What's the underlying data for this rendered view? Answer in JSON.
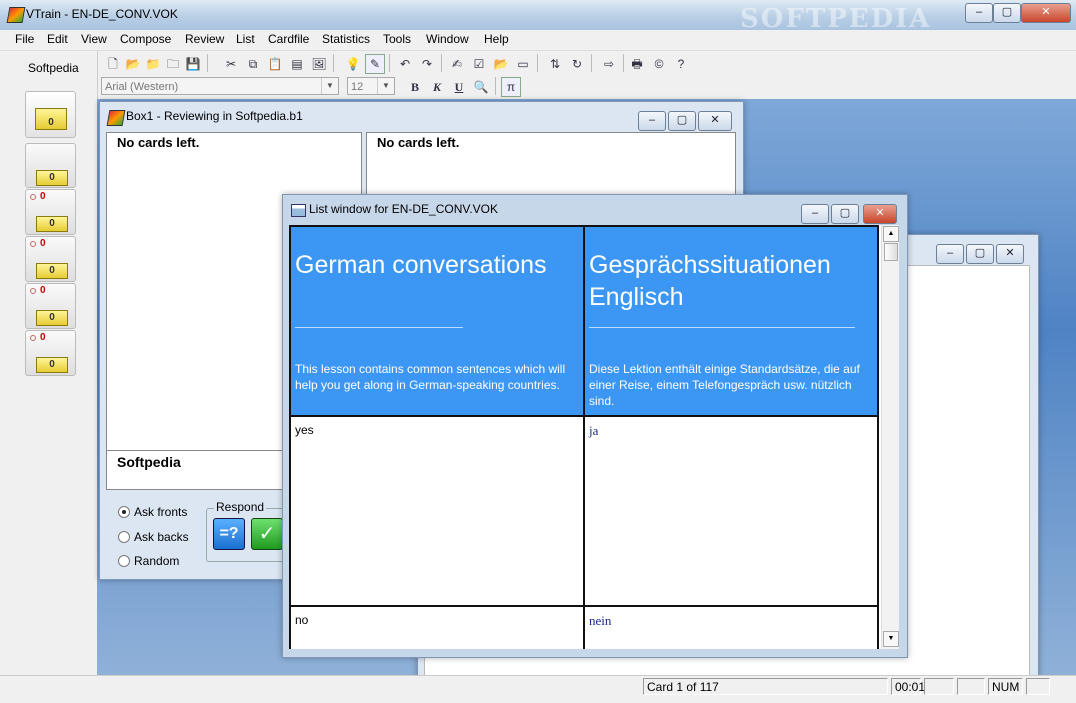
{
  "window": {
    "title": "VTrain - EN-DE_CONV.VOK",
    "watermark": "SOFTPEDIA",
    "min": "–",
    "max": "▢",
    "close": "✕"
  },
  "menu": [
    "File",
    "Edit",
    "View",
    "Compose",
    "Review",
    "List",
    "Cardfile",
    "Statistics",
    "Tools",
    "Window",
    "Help"
  ],
  "toolbar": {
    "font_name": "Arial (Western)",
    "font_size": "12",
    "bold": "B",
    "italic": "K",
    "underline": "U"
  },
  "left_panel": {
    "label": "Softpedia",
    "boxes": [
      {
        "count": "",
        "value": "0"
      },
      {
        "count": "",
        "value": "0"
      },
      {
        "count": "0",
        "value": "0"
      },
      {
        "count": "0",
        "value": "0"
      },
      {
        "count": "0",
        "value": "0"
      },
      {
        "count": "0",
        "value": "0"
      }
    ]
  },
  "review_window": {
    "title": "Box1 - Reviewing in Softpedia.b1",
    "left_pane": "No cards left.",
    "right_pane": "No cards left.",
    "bottom_text": "Softpedia",
    "options": [
      "Ask fronts",
      "Ask backs",
      "Random"
    ],
    "selected_option": "Ask fronts",
    "respond_label": "Respond",
    "btn_equal": "=?",
    "btn_check": "✓"
  },
  "list_window": {
    "title": "List window for EN-DE_CONV.VOK",
    "header_left": {
      "title": "German conversations",
      "desc": "This lesson contains common sentences which will help you get along in German-speaking countries."
    },
    "header_right": {
      "title": "Gesprächssituationen Englisch",
      "desc": "Diese Lektion enthält einige Standardsätze, die auf einer Reise, einem Telefongespräch usw. nützlich sind."
    },
    "rows": [
      {
        "en": "yes",
        "de": "ja"
      },
      {
        "en": "no",
        "de": "nein"
      }
    ]
  },
  "status": {
    "card": "Card 1 of 117",
    "time": "00:01",
    "num": "NUM"
  }
}
